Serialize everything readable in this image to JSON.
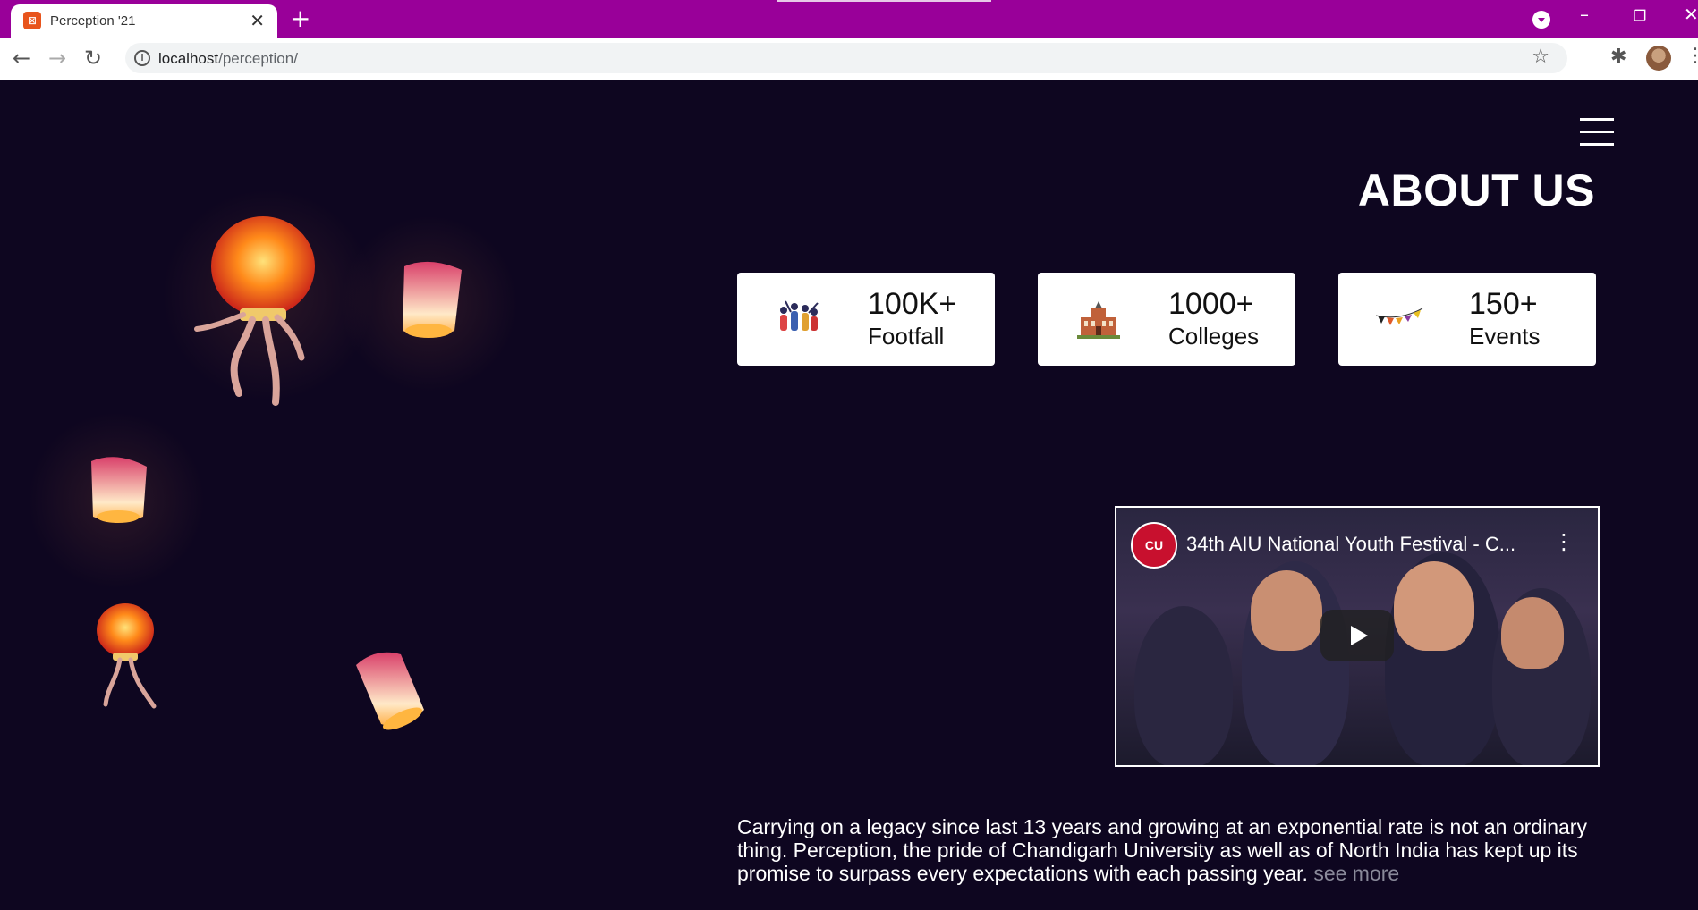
{
  "browser": {
    "tab_title": "Perception '21",
    "favicon_glyph": "⊠",
    "new_tab": "+",
    "tab_close": "✕",
    "url_host": "localhost",
    "url_path": "/perception/",
    "icons": [
      "back-arrow-icon",
      "forward-arrow-icon",
      "reload-icon",
      "info-icon",
      "star-icon",
      "puzzle-extensions-icon",
      "profile-avatar",
      "more-vert-icon"
    ],
    "chrome_color": "#990099"
  },
  "page": {
    "section_title": "ABOUT US",
    "stats": [
      {
        "value": "100K+",
        "label": "Footfall",
        "icon": "crowd-icon"
      },
      {
        "value": "1000+",
        "label": "Colleges",
        "icon": "college-building-icon"
      },
      {
        "value": "150+",
        "label": "Events",
        "icon": "bunting-flags-icon"
      }
    ],
    "video": {
      "channel_logo_text": "CU",
      "title": "34th AIU National Youth Festival - C..."
    },
    "description": "Carrying on a legacy since last 13 years and growing at an exponential rate is not an ordinary thing. Perception, the pride of Chandigarh University as well as of North India has kept up its promise to surpass every expectations with each passing year.",
    "see_more": "see more",
    "background_color": "#0e0620"
  }
}
